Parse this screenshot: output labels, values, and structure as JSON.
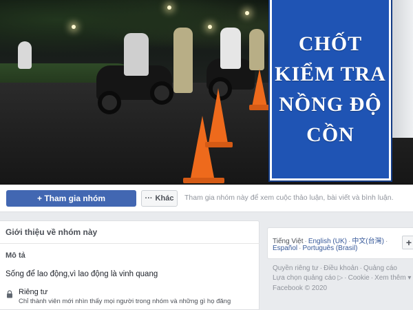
{
  "cover": {
    "sign_lines": [
      "CHỐT",
      "KIỂM TRA",
      "NỒNG ĐỘ",
      "CỒN"
    ]
  },
  "actions": {
    "join_icon": "plus-icon",
    "join_label": "+ Tham gia nhóm",
    "more_label": "Khác",
    "more_icon": "ellipsis-icon",
    "join_note": "Tham gia nhóm này để xem cuộc thảo luận, bài viết và bình luận."
  },
  "about": {
    "title": "Giới thiệu về nhóm này",
    "description_label": "Mô tả",
    "description": "Sống để lao động,vì lao động là vinh quang",
    "privacy_icon": "lock-icon",
    "privacy_label": "Riêng tư",
    "privacy_desc": "Chỉ thành viên mới nhìn thấy mọi người trong nhóm và những gì họ đăng"
  },
  "languages": {
    "current": "Tiếng Việt",
    "links": [
      "English (UK)",
      "中文(台灣)",
      "Español",
      "Português (Brasil)"
    ],
    "add_label": "+"
  },
  "footer": {
    "row1": [
      "Quyền riêng tư",
      "Điều khoản",
      "Quảng cáo"
    ],
    "row2": [
      "Lựa chọn quảng cáo ▷",
      "Cookie",
      "Xem thêm ▾"
    ],
    "copyright": "Facebook © 2020"
  },
  "colors": {
    "primary": "#4267b2",
    "sign_blue": "#1f54b4",
    "cone_orange": "#ee6a1c",
    "link": "#365899"
  }
}
